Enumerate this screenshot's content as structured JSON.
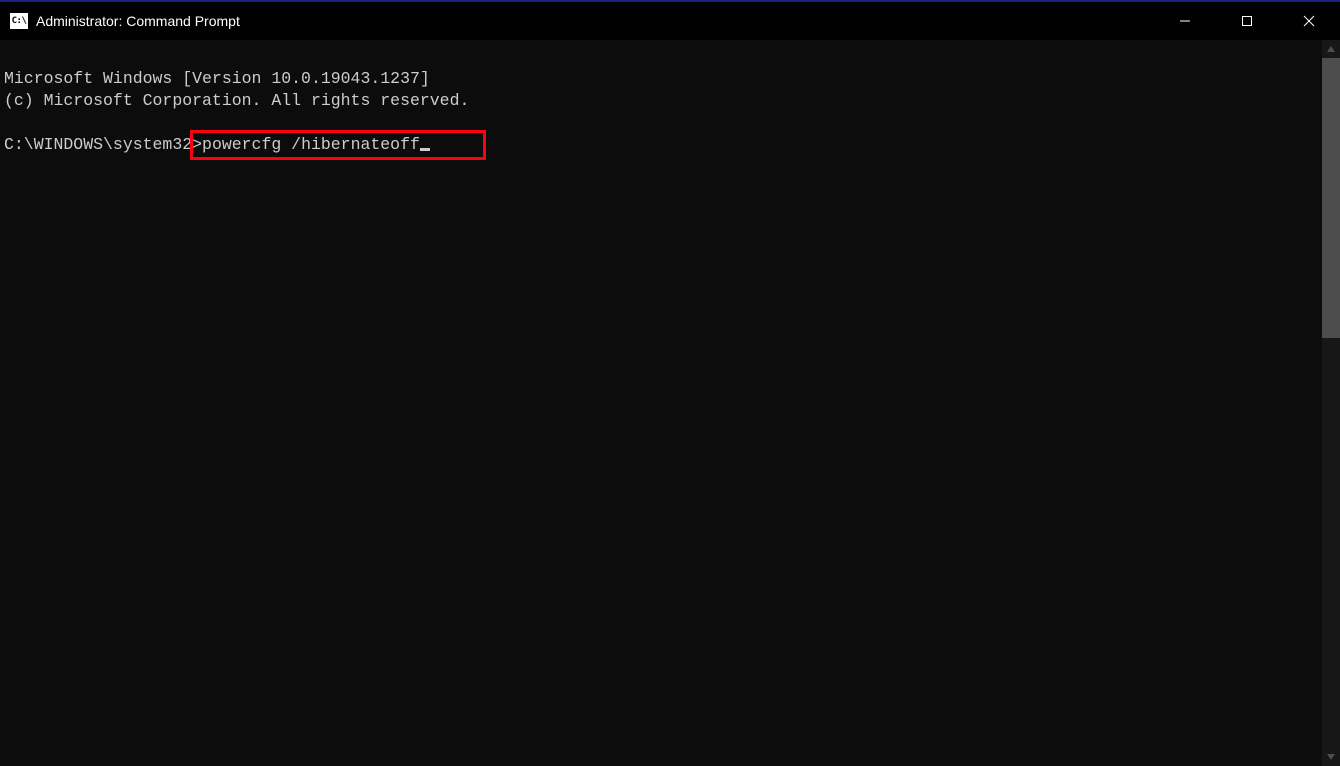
{
  "titlebar": {
    "icon_label": "C:\\",
    "title": "Administrator: Command Prompt"
  },
  "console": {
    "line1": "Microsoft Windows [Version 10.0.19043.1237]",
    "line2": "(c) Microsoft Corporation. All rights reserved.",
    "prompt": "C:\\WINDOWS\\system32>",
    "command": "powercfg /hibernateoff"
  }
}
